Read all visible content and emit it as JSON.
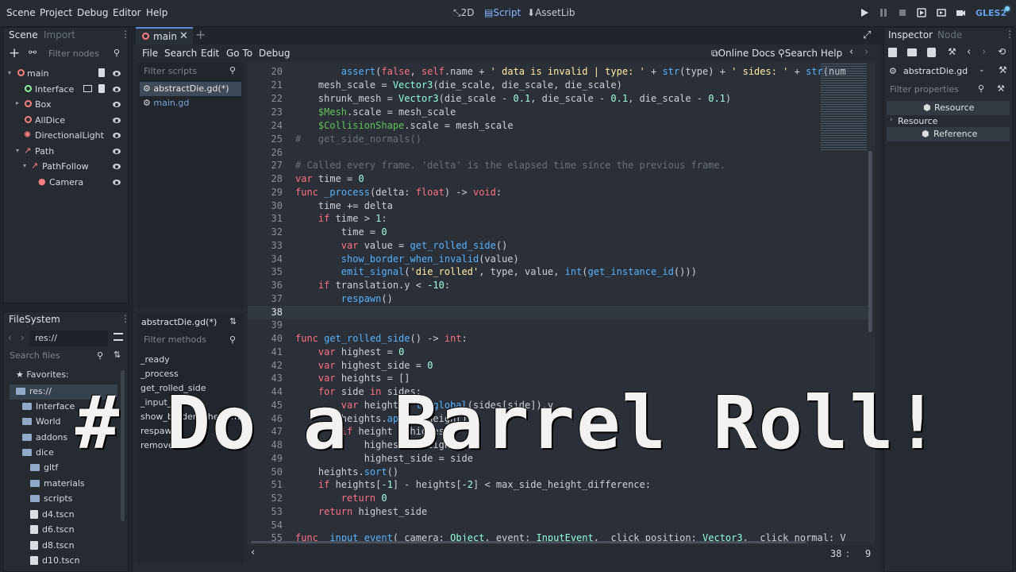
{
  "topbar": {
    "menus": [
      "Scene",
      "Project",
      "Debug",
      "Editor",
      "Help"
    ],
    "workspaces": [
      "2D",
      "Script",
      "AssetLib"
    ],
    "renderer": "GLES2"
  },
  "scene_dock": {
    "tabs": [
      "Scene",
      "Import"
    ],
    "filter_placeholder": "Filter nodes",
    "nodes": [
      {
        "name": "main",
        "indent": 0
      },
      {
        "name": "Interface",
        "indent": 1
      },
      {
        "name": "Box",
        "indent": 1
      },
      {
        "name": "AllDice",
        "indent": 1
      },
      {
        "name": "DirectionalLight",
        "indent": 1
      },
      {
        "name": "Path",
        "indent": 1
      },
      {
        "name": "PathFollow",
        "indent": 2
      },
      {
        "name": "Camera",
        "indent": 3
      }
    ]
  },
  "filesystem_dock": {
    "tab": "FileSystem",
    "path": "res://",
    "search_placeholder": "Search files",
    "favorites_label": "Favorites:",
    "items": [
      "res://",
      "Interface",
      "World",
      "addons",
      "dice",
      "gltf",
      "materials",
      "scripts",
      "d4.tscn",
      "d6.tscn",
      "d8.tscn",
      "d10.tscn"
    ]
  },
  "editor": {
    "open_tab": "main",
    "menus": [
      "File",
      "Search",
      "Edit",
      "Go To",
      "Debug"
    ],
    "online_docs": "Online Docs",
    "search_help": "Search Help",
    "filter_scripts_placeholder": "Filter scripts",
    "scripts": [
      "abstractDie.gd(*)",
      "main.gd"
    ],
    "current_script_label": "abstractDie.gd(*)",
    "filter_methods_placeholder": "Filter methods",
    "methods": [
      "_ready",
      "_process",
      "get_rolled_side",
      "_input_event",
      "show_border_when_invalid",
      "respawn",
      "remove"
    ],
    "line_numbers": [
      "20",
      "21",
      "22",
      "23",
      "24",
      "25",
      "26",
      "27",
      "28",
      "29",
      "30",
      "31",
      "32",
      "33",
      "34",
      "35",
      "36",
      "37",
      "38",
      "39",
      "40",
      "41",
      "42",
      "43",
      "44",
      "45",
      "46",
      "47",
      "48",
      "49",
      "50",
      "51",
      "52",
      "53",
      "54",
      "55"
    ],
    "status_line": "38",
    "status_col": "9"
  },
  "inspector": {
    "tabs": [
      "Inspector",
      "Node"
    ],
    "object": "abstractDie.gd",
    "filter_placeholder": "Filter properties",
    "section_resource": "Resource",
    "group_resource": "Resource",
    "section_reference": "Reference"
  },
  "overlay_text": "# Do a Barrel Roll!"
}
